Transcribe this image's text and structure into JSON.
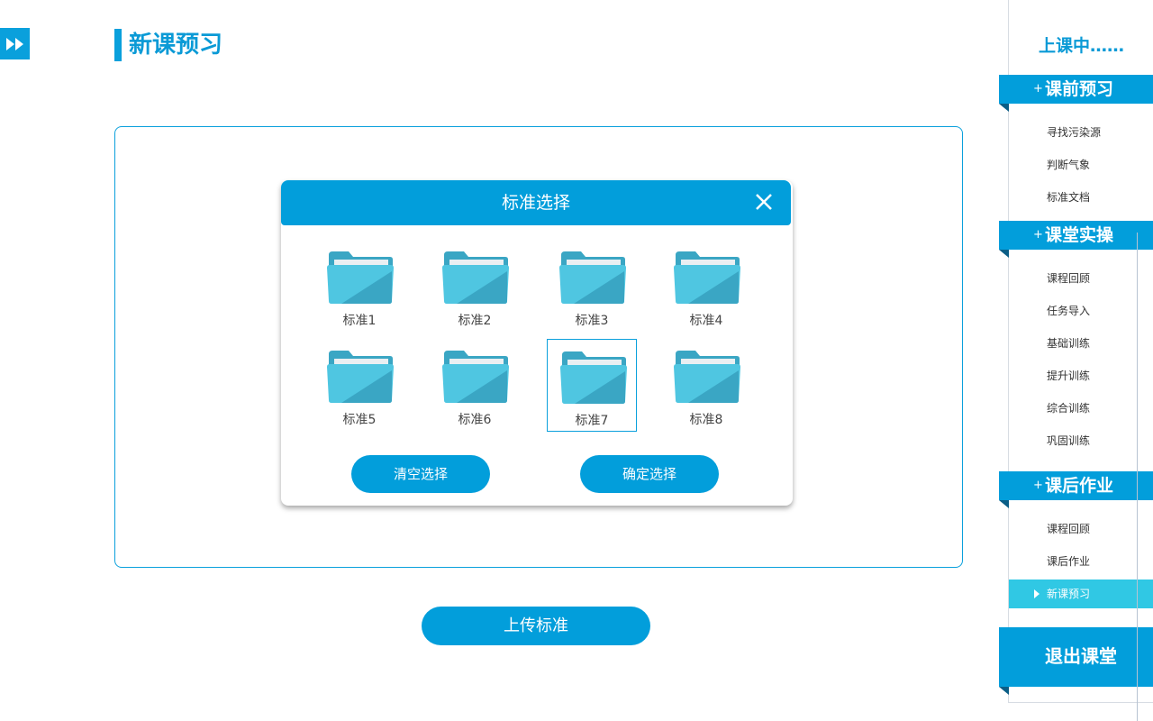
{
  "header": {
    "title": "新课预习",
    "expand_icon": "fast-forward-icon"
  },
  "dialog": {
    "title": "标准选择",
    "close_icon": "close-icon",
    "folders": [
      {
        "label": "标准1",
        "selected": false
      },
      {
        "label": "标准2",
        "selected": false
      },
      {
        "label": "标准3",
        "selected": false
      },
      {
        "label": "标准4",
        "selected": false
      },
      {
        "label": "标准5",
        "selected": false
      },
      {
        "label": "标准6",
        "selected": false
      },
      {
        "label": "标准7",
        "selected": true
      },
      {
        "label": "标准8",
        "selected": false
      }
    ],
    "clear_label": "清空选择",
    "confirm_label": "确定选择"
  },
  "upload_label": "上传标准",
  "sidebar": {
    "status": "上课中……",
    "sections": [
      {
        "plus": "+",
        "label": "课前预习",
        "items": [
          "寻找污染源",
          "判断气象",
          "标准文档"
        ]
      },
      {
        "plus": "+",
        "label": "课堂实操",
        "items": [
          "课程回顾",
          "任务导入",
          "基础训练",
          "提升训练",
          "综合训练",
          "巩固训练"
        ]
      },
      {
        "plus": "+",
        "label": "课后作业",
        "items": [
          "课程回顾",
          "课后作业",
          "新课预习"
        ]
      }
    ],
    "active_item": "新课预习",
    "exit_label": "退出课堂"
  },
  "colors": {
    "primary": "#029edb",
    "active_item": "#30c8e4",
    "folder_light": "#4fc6e1",
    "folder_dark": "#3aa6c4"
  }
}
